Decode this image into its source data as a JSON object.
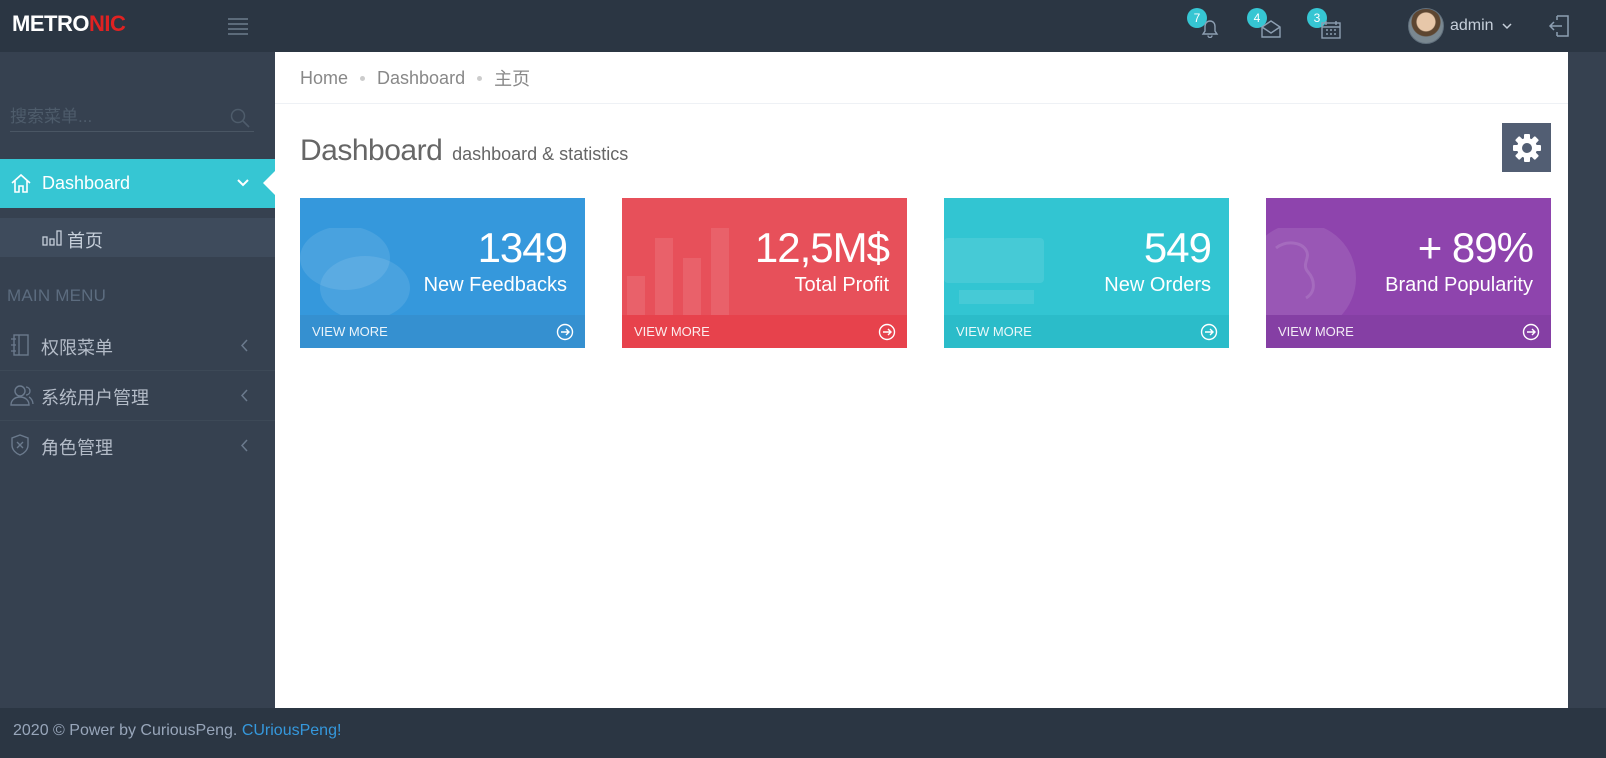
{
  "header": {
    "logo_main": "METRO",
    "logo_accent": "NIC",
    "notifications_count": "7",
    "inbox_count": "4",
    "tasks_count": "3",
    "username": "admin"
  },
  "sidebar": {
    "search_placeholder": "搜索菜单...",
    "active_item": {
      "label": "Dashboard",
      "icon": "home-icon"
    },
    "sub_item": {
      "label": "首页",
      "icon": "bar-chart-icon"
    },
    "heading": "MAIN MENU",
    "items": [
      {
        "label": "权限菜单",
        "icon": "notebook-icon"
      },
      {
        "label": "系统用户管理",
        "icon": "users-icon"
      },
      {
        "label": "角色管理",
        "icon": "shield-icon"
      }
    ]
  },
  "breadcrumb": [
    "Home",
    "Dashboard",
    "主页"
  ],
  "page": {
    "title": "Dashboard",
    "subtitle": "dashboard & statistics"
  },
  "stats": [
    {
      "number": "1349",
      "label": "New Feedbacks",
      "more": "VIEW MORE",
      "color": "#3598dc",
      "more_color": "#3590d0"
    },
    {
      "number": "12,5M$",
      "label": "Total Profit",
      "more": "VIEW MORE",
      "color": "#e7505a",
      "more_color": "#e7424c"
    },
    {
      "number": "549",
      "label": "New Orders",
      "more": "VIEW MORE",
      "color": "#32c5d2",
      "more_color": "#2bbcc9"
    },
    {
      "number": "+ 89%",
      "label": "Brand Popularity",
      "more": "VIEW MORE",
      "color": "#8e44ad",
      "more_color": "#853fa4"
    }
  ],
  "footer": {
    "text": "2020 © Power by CuriousPeng.",
    "link": "CUriousPeng!"
  },
  "colors": {
    "header_bg": "#2b3643",
    "sidebar_bg": "#364150",
    "active_bg": "#36c6d3",
    "badge_bg": "#36c6d3"
  }
}
